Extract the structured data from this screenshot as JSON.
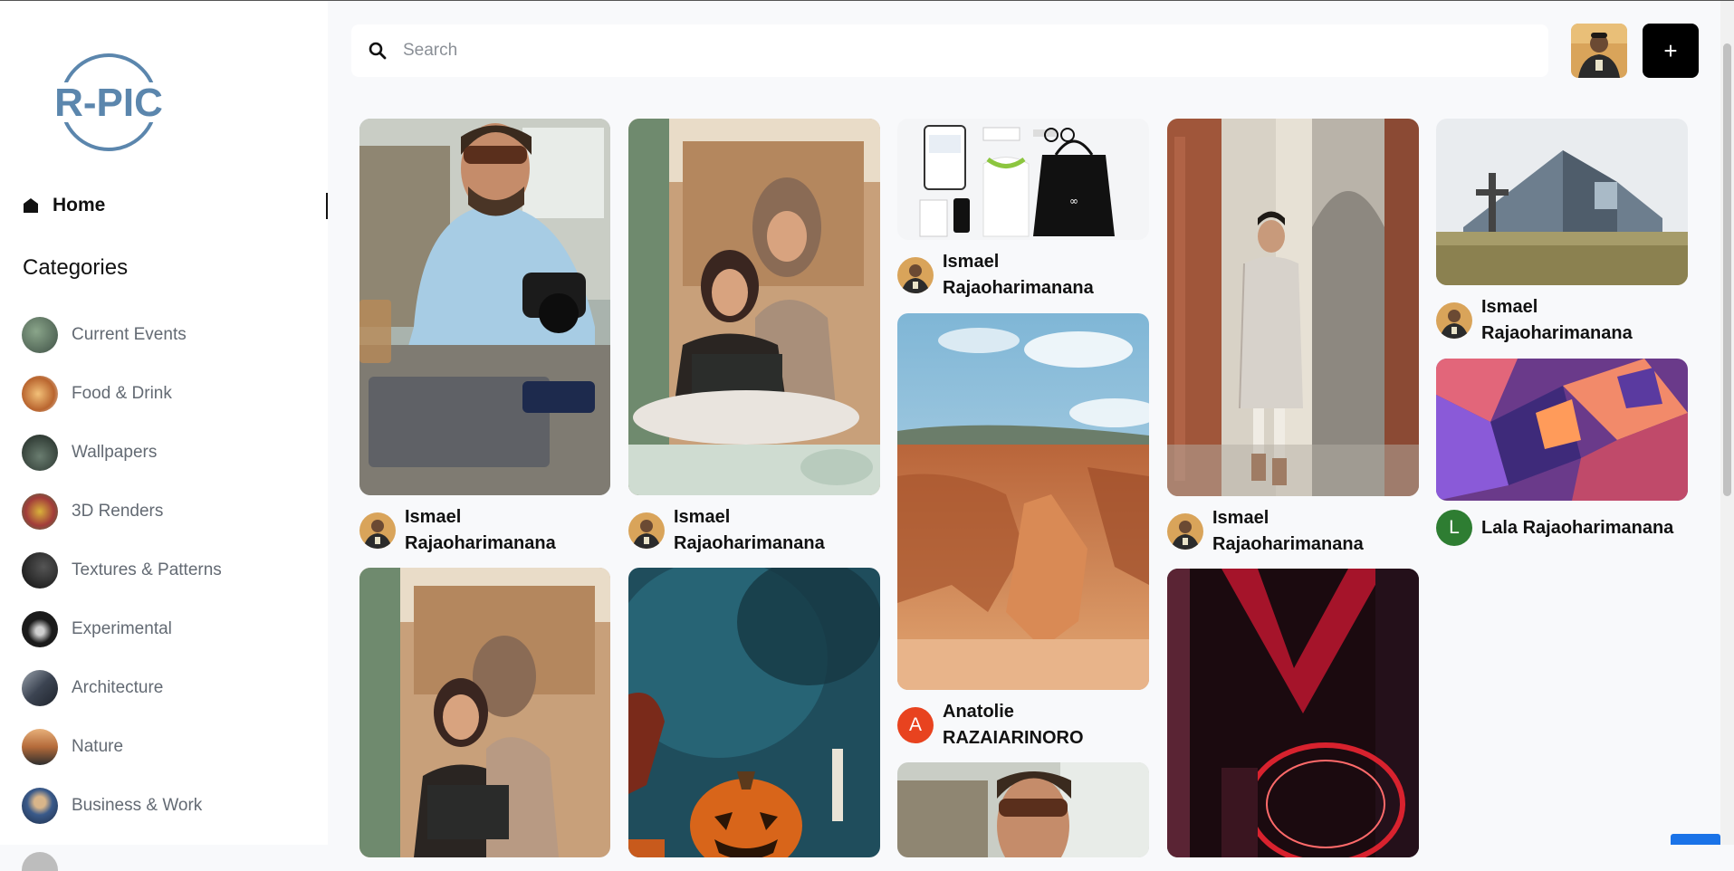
{
  "app": {
    "logo_text": "R-PIC",
    "brand_color": "#5b86ad"
  },
  "nav": {
    "home_label": "Home",
    "categories_title": "Categories",
    "categories": [
      {
        "label": "Current Events",
        "thumb_color": "#5a6f5e"
      },
      {
        "label": "Food & Drink",
        "thumb_color": "#c78b58"
      },
      {
        "label": "Wallpapers",
        "thumb_color": "#2f3b34"
      },
      {
        "label": "3D Renders",
        "thumb_color": "#a23c3a"
      },
      {
        "label": "Textures & Patterns",
        "thumb_color": "#1c1c1c"
      },
      {
        "label": "Experimental",
        "thumb_color": "#2a2a2a"
      },
      {
        "label": "Architecture",
        "thumb_color": "#3c4452"
      },
      {
        "label": "Nature",
        "thumb_color": "#b46a3a"
      },
      {
        "label": "Business & Work",
        "thumb_color": "#3a5a8a"
      },
      {
        "label": "",
        "thumb_color": "#bdbdbd"
      }
    ]
  },
  "search": {
    "placeholder": "Search",
    "value": ""
  },
  "header": {
    "add_label": "+"
  },
  "pins": [
    {
      "author": "Ismael Rajaoharimanana",
      "avatar": "photo"
    },
    {
      "author": "Ismael Rajaoharimanana",
      "avatar": "photo"
    },
    {
      "author": "Ismael Rajaoharimanana",
      "avatar": "photo"
    },
    {
      "author": "Ismael Rajaoharimanana",
      "avatar": "photo"
    },
    {
      "author": "Ismael Rajaoharimanana",
      "avatar": "photo"
    },
    {
      "author": "Anatolie RAZAIARINORO",
      "avatar": "letter",
      "avatar_letter": "A",
      "avatar_color": "#e8431f"
    },
    {
      "author": "Lala Rajaoharimanana",
      "avatar": "letter",
      "avatar_letter": "L",
      "avatar_color": "#2e7d32"
    }
  ]
}
